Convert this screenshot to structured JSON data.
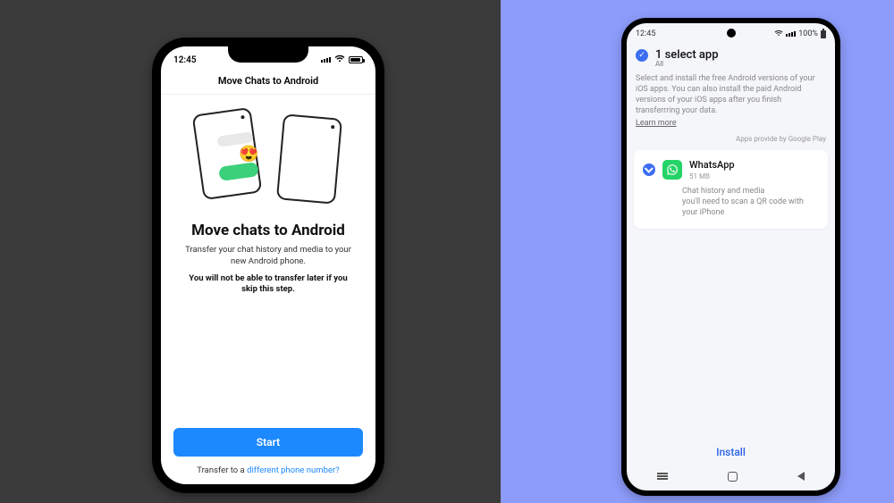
{
  "ios": {
    "status_time": "12:45",
    "title_bar": "Move Chats to Android",
    "headline": "Move chats to Android",
    "subtext": "Transfer your chat history and media to your new Android phone.",
    "warning": "You will not be able to transfer later if you skip this step.",
    "start_label": "Start",
    "alt_prefix": "Transfer to a ",
    "alt_link": "different phone number?"
  },
  "android": {
    "status_time": "12:45",
    "status_batt": "100%",
    "step_title": "1 select app",
    "step_all": "All",
    "description": "Select and install rhe free Android versions of your iOS apps. You can also install the paid Android versions of your iOS apps after you finish transferrring your data.",
    "learn_more": "Learn more",
    "provider": "Apps provide by Google Play",
    "app": {
      "name": "WhatsApp",
      "size": "51 MB",
      "desc_line1": "Chat history and media",
      "desc_line2": "you'll need to scan a QR code with your iPhone"
    },
    "install_label": "Install"
  }
}
